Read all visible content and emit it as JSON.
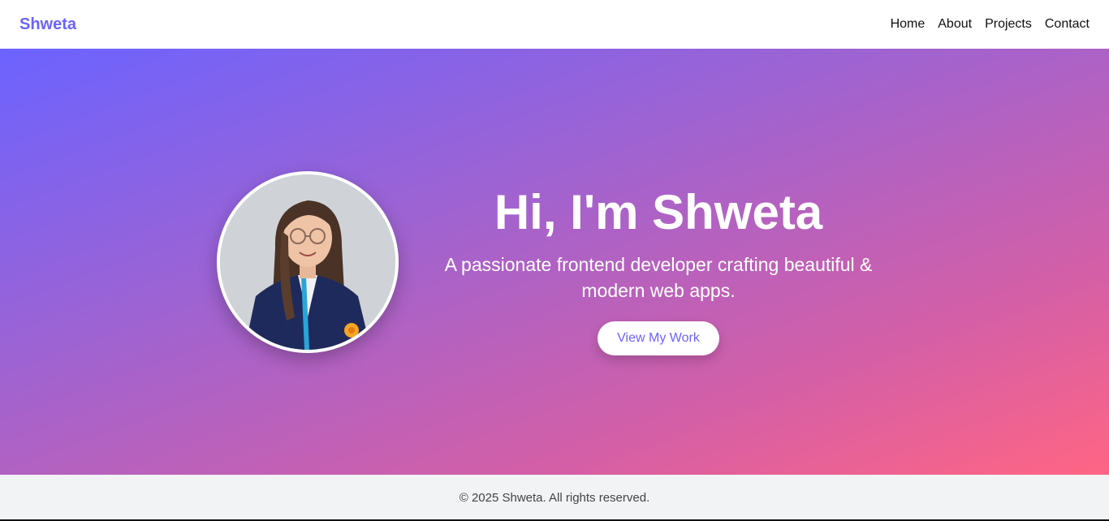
{
  "navbar": {
    "brand": "Shweta",
    "links": [
      {
        "label": "Home"
      },
      {
        "label": "About"
      },
      {
        "label": "Projects"
      },
      {
        "label": "Contact"
      }
    ]
  },
  "hero": {
    "title": "Hi, I'm Shweta",
    "subtitle": "A passionate frontend developer crafting beautiful & modern web apps.",
    "cta_label": "View My Work",
    "avatar_alt": "Profile photo of Shweta"
  },
  "footer": {
    "copyright": "© 2025 Shweta. All rights reserved."
  },
  "colors": {
    "accent": "#6c63ff",
    "gradient_start": "#6c63ff",
    "gradient_end": "#ff6584",
    "text_on_hero": "#ffffff",
    "footer_bg": "#f2f3f5"
  }
}
